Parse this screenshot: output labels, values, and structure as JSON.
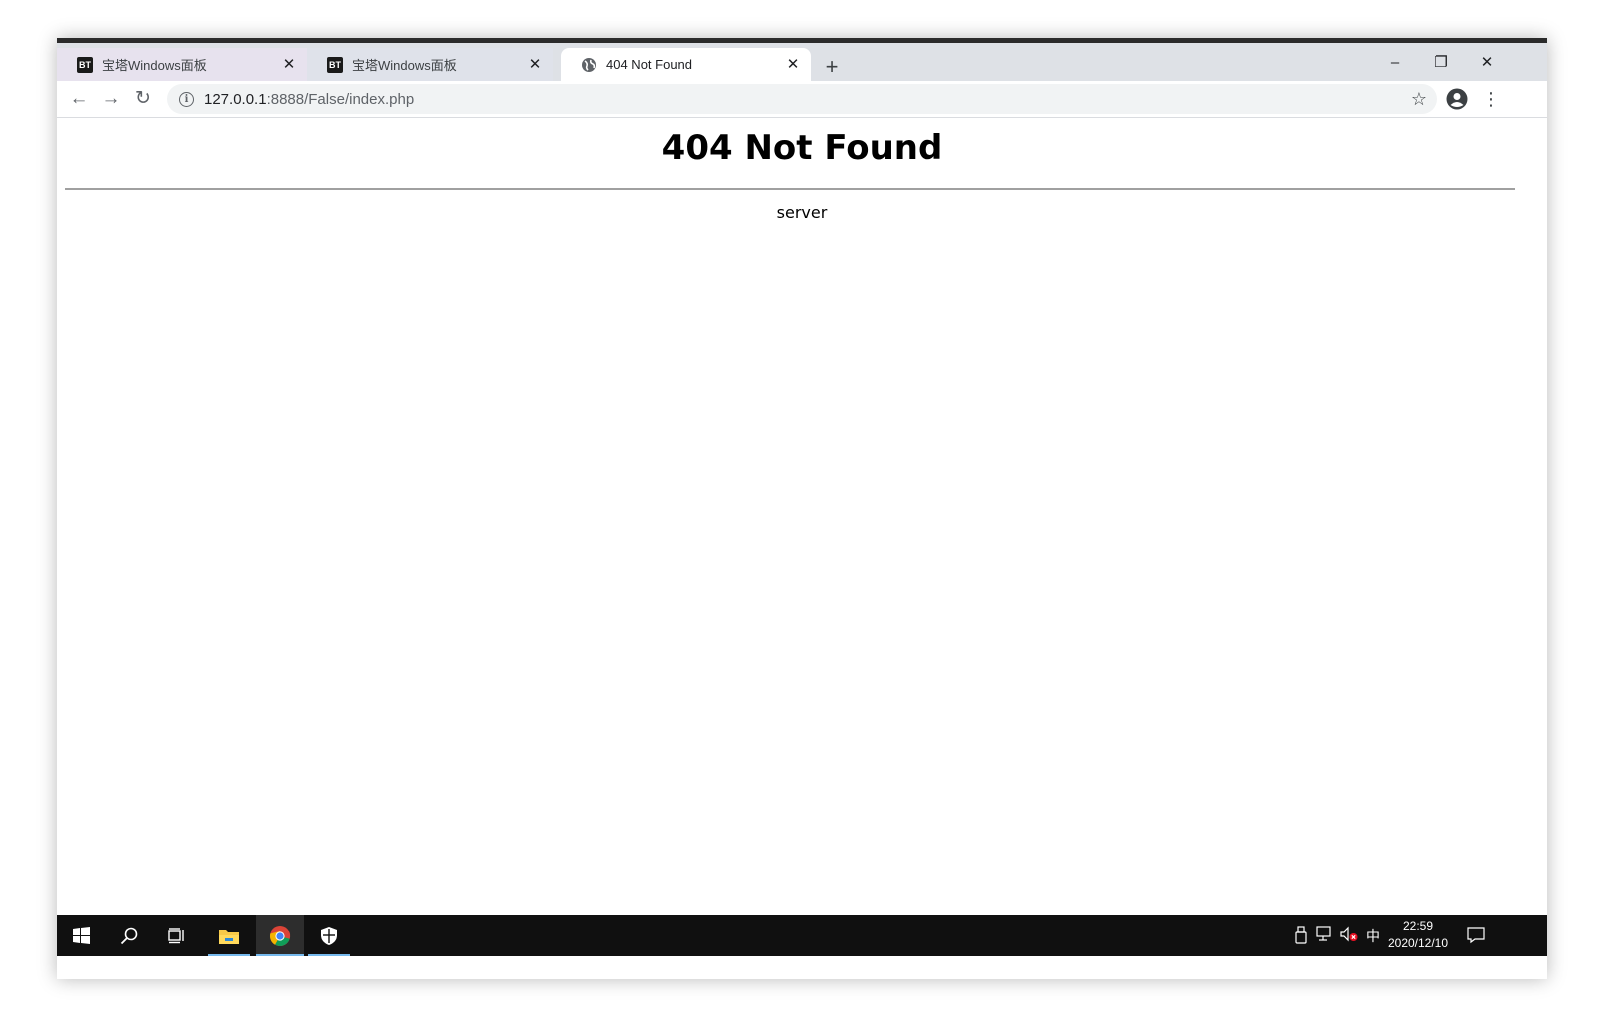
{
  "browser": {
    "tabs": [
      {
        "title": "宝塔Windows面板",
        "favicon": "BT"
      },
      {
        "title": "宝塔Windows面板",
        "favicon": "BT"
      },
      {
        "title": "404 Not Found",
        "favicon": "globe-icon"
      }
    ],
    "close_glyph": "✕",
    "new_tab_glyph": "+",
    "window_controls": {
      "minimize": "–",
      "restore": "❐",
      "close": "✕"
    },
    "address": {
      "host": "127.0.0.1",
      "path": ":8888/False/index.php"
    },
    "nav": {
      "back": "←",
      "forward": "→",
      "reload": "↻"
    },
    "star_glyph": "☆",
    "menu_glyph": "⋮"
  },
  "page": {
    "heading": "404 Not Found",
    "server_text": "server"
  },
  "taskbar": {
    "time": "22:59",
    "date": "2020/12/10",
    "ime": "中"
  },
  "colors": {
    "tabstrip": "#dee1e6",
    "taskbar": "#101010",
    "taskbar_accent": "#76b9ed"
  }
}
